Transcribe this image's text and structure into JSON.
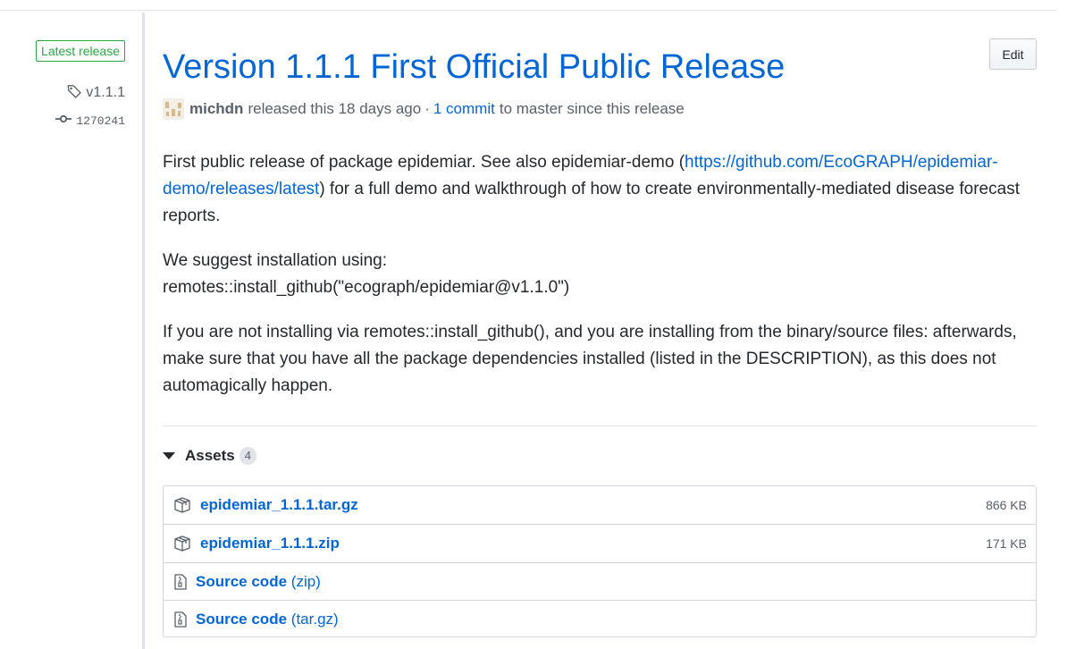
{
  "sidebar": {
    "badge": "Latest release",
    "tag": "v1.1.1",
    "commit": "1270241"
  },
  "release": {
    "title": "Version 1.1.1 First Official Public Release",
    "edit_label": "Edit",
    "author": "michdn",
    "released_text": "released this 18 days ago",
    "separator": "·",
    "commits_link": "1 commit",
    "commits_suffix": "to master since this release"
  },
  "body": {
    "p1_before": "First public release of package epidemiar. See also epidemiar-demo (",
    "p1_link": "https://github.com/EcoGRAPH/epidemiar-demo/releases/latest",
    "p1_after": ") for a full demo and walkthrough of how to create environmentally-mediated disease forecast reports.",
    "p2_line1": "We suggest installation using:",
    "p2_line2": "remotes::install_github(\"ecograph/epidemiar@v1.1.0\")",
    "p3": "If you are not installing via remotes::install_github(), and you are installing from the binary/source files: afterwards, make sure that you have all the package dependencies installed (listed in the DESCRIPTION), as this does not automagically happen."
  },
  "assets": {
    "label": "Assets",
    "count": "4",
    "items": [
      {
        "name": "epidemiar_1.1.1.tar.gz",
        "size": "866 KB",
        "icon": "package-icon"
      },
      {
        "name": "epidemiar_1.1.1.zip",
        "size": "171 KB",
        "icon": "package-icon"
      },
      {
        "name": "Source code",
        "suffix": "(zip)",
        "icon": "file-zip-icon"
      },
      {
        "name": "Source code",
        "suffix": "(tar.gz)",
        "icon": "file-zip-icon"
      }
    ]
  },
  "colors": {
    "link": "#0366d6",
    "badge_green": "#28a745",
    "muted": "#586069",
    "border": "#d1d5da"
  }
}
